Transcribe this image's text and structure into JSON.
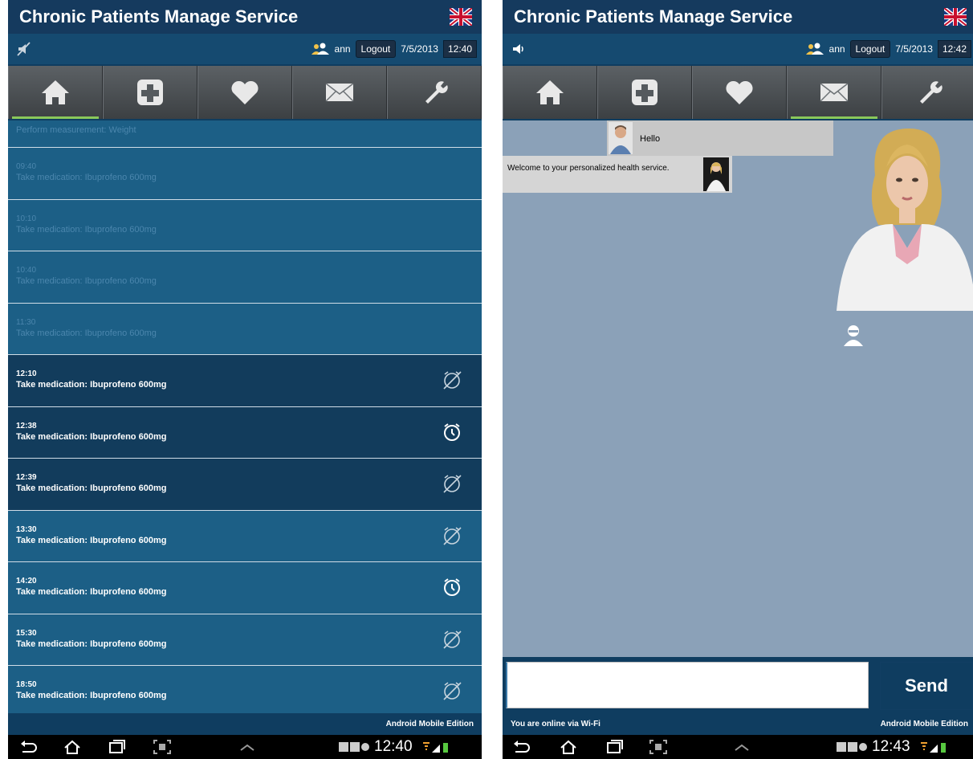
{
  "left_screen": {
    "app_title": "Chronic Patients Manage Service",
    "status": {
      "user": "ann",
      "logout_label": "Logout",
      "date": "7/5/2013",
      "time": "12:40"
    },
    "tabs": [
      "home",
      "medical",
      "health",
      "messages",
      "settings"
    ],
    "active_tab": "home",
    "list": [
      {
        "time": "",
        "text": "Perform measurement: Weight",
        "state": "past",
        "icon": ""
      },
      {
        "time": "09:40",
        "text": "Take medication: Ibuprofeno 600mg",
        "state": "past",
        "icon": ""
      },
      {
        "time": "10:10",
        "text": "Take medication: Ibuprofeno 600mg",
        "state": "past",
        "icon": ""
      },
      {
        "time": "10:40",
        "text": "Take medication: Ibuprofeno 600mg",
        "state": "past",
        "icon": ""
      },
      {
        "time": "11:30",
        "text": "Take medication: Ibuprofeno 600mg",
        "state": "past",
        "icon": ""
      },
      {
        "time": "12:10",
        "text": "Take medication: Ibuprofeno 600mg",
        "state": "current",
        "icon": "alarm-off-icon"
      },
      {
        "time": "12:38",
        "text": "Take medication: Ibuprofeno 600mg",
        "state": "current",
        "icon": "alarm-clock-icon"
      },
      {
        "time": "12:39",
        "text": "Take medication: Ibuprofeno 600mg",
        "state": "current",
        "icon": "alarm-off-icon"
      },
      {
        "time": "13:30",
        "text": "Take medication: Ibuprofeno 600mg",
        "state": "future",
        "icon": "alarm-off-icon"
      },
      {
        "time": "14:20",
        "text": "Take medication: Ibuprofeno 600mg",
        "state": "future",
        "icon": "alarm-clock-icon"
      },
      {
        "time": "15:30",
        "text": "Take medication: Ibuprofeno 600mg",
        "state": "future",
        "icon": "alarm-off-icon"
      },
      {
        "time": "18:50",
        "text": "Take medication: Ibuprofeno 600mg",
        "state": "future",
        "icon": "alarm-off-icon"
      }
    ],
    "footer": {
      "edition": "Android Mobile Edition"
    },
    "system_clock": "12:40"
  },
  "right_screen": {
    "app_title": "Chronic Patients Manage Service",
    "status": {
      "user": "ann",
      "logout_label": "Logout",
      "date": "7/5/2013",
      "time": "12:42"
    },
    "active_tab": "messages",
    "messages": [
      {
        "from": "user",
        "text": "Hello"
      },
      {
        "from": "assistant",
        "text": "Welcome to your personalized health service."
      }
    ],
    "compose": {
      "input_value": "",
      "send_label": "Send"
    },
    "footer": {
      "online": "You are online via Wi-Fi",
      "edition": "Android Mobile Edition"
    },
    "system_clock": "12:43"
  },
  "colors": {
    "title_bar": "#153a5e",
    "list_bg": "#1c5f86",
    "list_current": "#123c5c",
    "chat_bg": "#8ba1b8",
    "active_tab_indicator": "#8ac85a"
  }
}
